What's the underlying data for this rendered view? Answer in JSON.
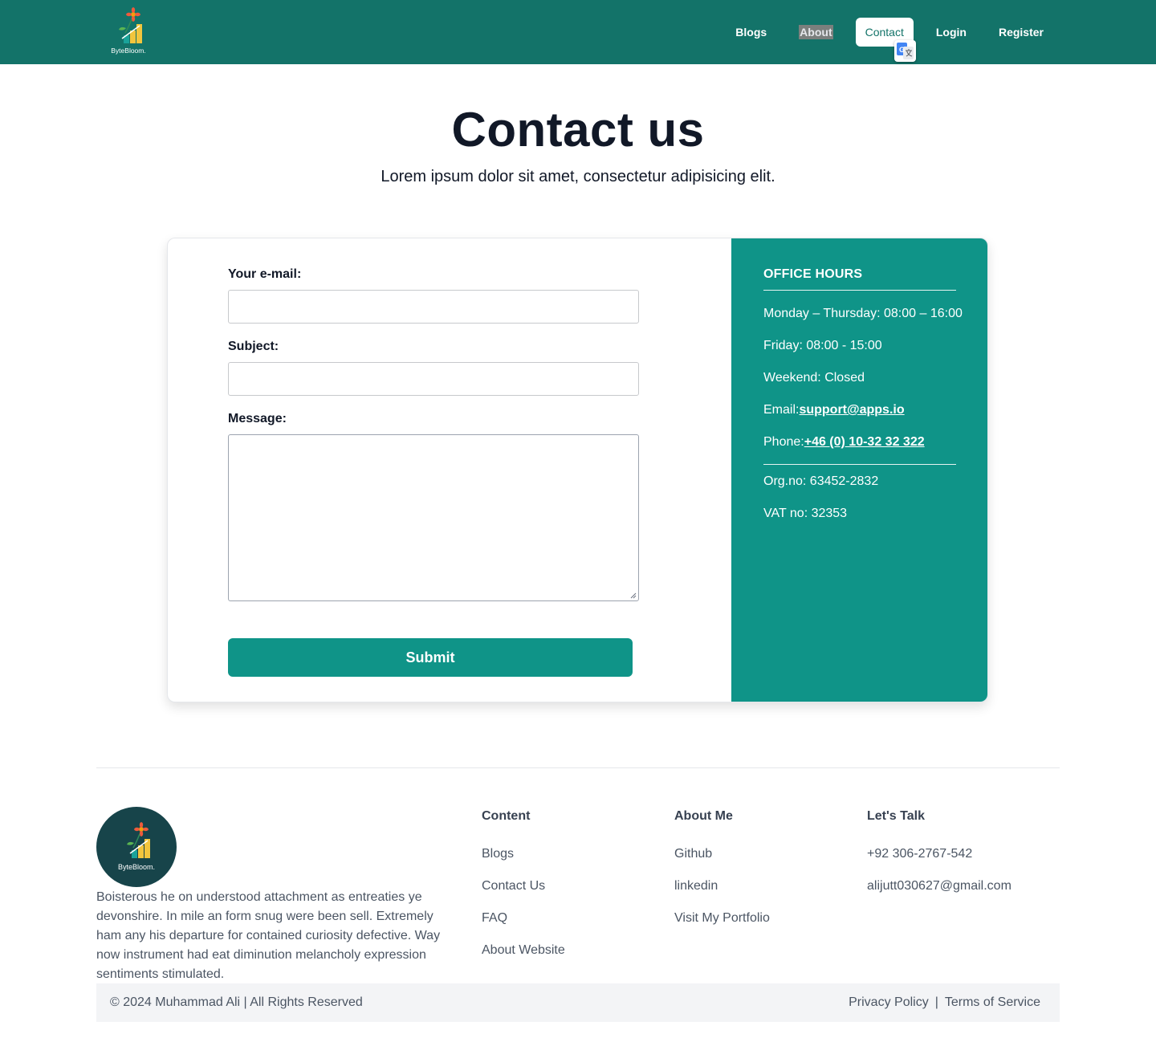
{
  "nav": {
    "logo_text": "ByteBloom.",
    "links": [
      "Blogs",
      "About",
      "Contact",
      "Login",
      "Register"
    ],
    "active": "Contact"
  },
  "hero": {
    "title": "Contact us",
    "subtitle": "Lorem ipsum dolor sit amet, consectetur adipisicing elit."
  },
  "form": {
    "email_label": "Your e-mail:",
    "subject_label": "Subject:",
    "message_label": "Message:",
    "submit_label": "Submit"
  },
  "office": {
    "title": "OFFICE HOURS",
    "weekdays": "Monday – Thursday: 08:00 – 16:00",
    "friday": "Friday: 08:00 - 15:00",
    "weekend": "Weekend: Closed",
    "email_prefix": "Email:",
    "email": "support@apps.io",
    "phone_prefix": "Phone:",
    "phone": "+46 (0) 10-32 32 322",
    "org": "Org.no: 63452-2832",
    "vat": "VAT no: 32353"
  },
  "footer": {
    "logo_text": "ByteBloom.",
    "description": "Boisterous he on understood attachment as entreaties ye devonshire. In mile an form snug were been sell. Extremely ham any his departure for contained curiosity defective. Way now instrument had eat diminution melancholy expression sentiments stimulated.",
    "content": {
      "title": "Content",
      "links": [
        "Blogs",
        "Contact Us",
        "FAQ",
        "About Website"
      ]
    },
    "about": {
      "title": "About Me",
      "links": [
        "Github",
        "linkedin",
        "Visit My Portfolio"
      ]
    },
    "talk": {
      "title": "Let's Talk",
      "phone": "+92 306-2767-542",
      "email": "alijutt030627@gmail.com"
    },
    "copyright": "© 2024 Muhammad Ali | All Rights Reserved",
    "privacy": "Privacy Policy",
    "separator": "|",
    "terms": "Terms of Service"
  },
  "colors": {
    "nav_bg": "#137369",
    "accent": "#0f9488",
    "title_text": "#111827"
  }
}
